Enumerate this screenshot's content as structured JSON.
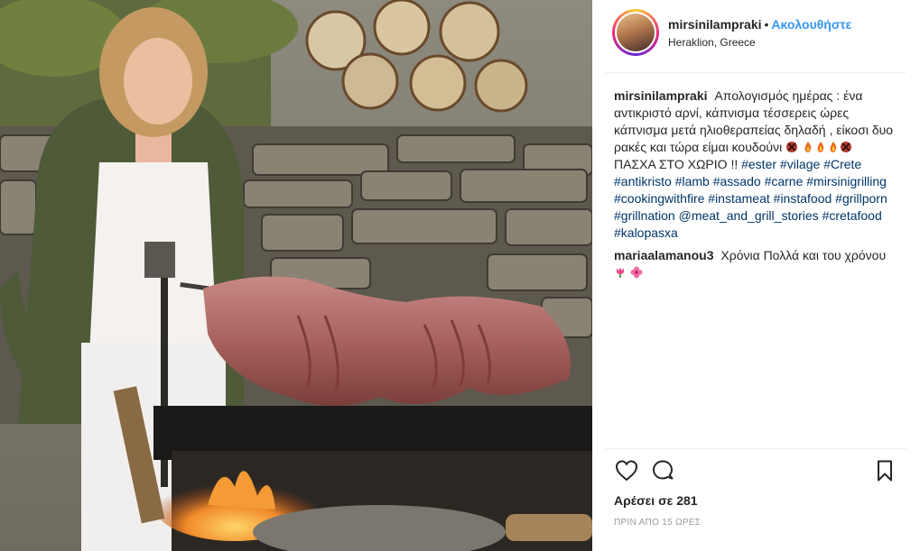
{
  "header": {
    "username": "mirsinilampraki",
    "separator": "•",
    "follow_label": "Ακολουθήστε",
    "location": "Heraklion, Greece"
  },
  "caption": {
    "username": "mirsinilampraki",
    "text_1": "Απολογισμός ημέρας : ένα αντικριστό αρνί, κάπνισμα τέσσερεις ώρες κάπνισμα μετά ηλιοθεραπείας δηλαδή , είκοσι δυο ρακές και τώρα είμαι κουδούνι",
    "text_2": "ΠΑΣΧΑ ΣΤΟ ΧΩΡΙΟ !!",
    "tags": [
      "#ester",
      "#vilage",
      "#Crete",
      "#antikristo",
      "#lamb",
      "#assado",
      "#carne",
      "#mirsinigrilling",
      "#cookingwithfire",
      "#instameat",
      "#instafood",
      "#grillporn",
      "#grillnation",
      "@meat_and_grill_stories",
      "#cretafood",
      "#kalopasxa"
    ]
  },
  "comment": {
    "username": "mariaalamanou3",
    "text": "Χρόνια Πολλά και του χρόνου"
  },
  "likes": "Αρέσει σε 281",
  "time": "ΠΡΙΝ ΑΠΟ 15 ΩΡΕΣ",
  "icons": {
    "like": "heart-icon",
    "comment": "comment-icon",
    "save": "bookmark-icon"
  }
}
